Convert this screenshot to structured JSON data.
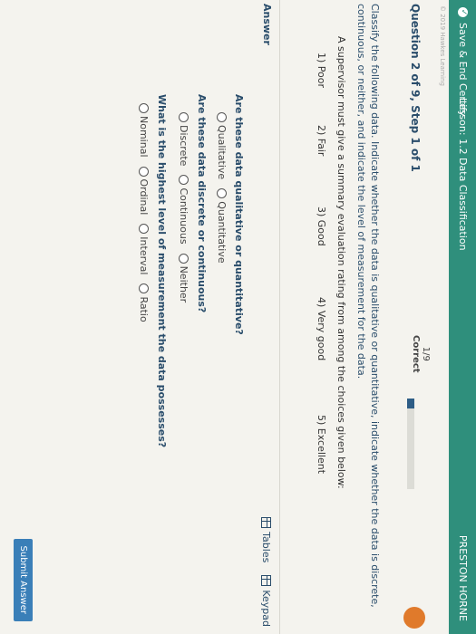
{
  "topbar": {
    "save_label": "Save & End Certify",
    "lesson": "Lesson: 1.2 Data Classification",
    "user": "PRESTON HORNE"
  },
  "footer_note": "© 2019 Hawkes Learning",
  "question": {
    "number": "Question 2 of 9, Step 1 of 1",
    "score": "1/9",
    "status": "Correct",
    "progress_fraction": 0.11
  },
  "instructions": "Classify the following data. Indicate whether the data is qualitative or quantitative, indicate whether the data is discrete, continuous, or neither, and indicate the level of measurement for the data.",
  "scenario": "A supervisor must give a summary evaluation rating from among the choices given below:",
  "rating_choices": [
    "1) Poor",
    "2) Fair",
    "3) Good",
    "4) Very good",
    "5) Excellent"
  ],
  "answer_label": "Answer",
  "tools": {
    "tables": "Tables",
    "keypad": "Keypad"
  },
  "q1": {
    "prompt": "Are these data qualitative or quantitative?",
    "options": [
      "Qualitative",
      "Quantitative"
    ]
  },
  "q2": {
    "prompt": "Are these data discrete or continuous?",
    "options": [
      "Discrete",
      "Continuous",
      "Neither"
    ]
  },
  "q3": {
    "prompt": "What is the highest level of measurement the data possesses?",
    "options": [
      "Nominal",
      "Ordinal",
      "Interval",
      "Ratio"
    ]
  },
  "submit_label": "Submit Answer",
  "colors": {
    "header": "#2f8f7c",
    "accent": "#2a4d6b",
    "progress": "#2e5d86",
    "submit": "#3a7fb8",
    "badge": "#e07a2b"
  }
}
